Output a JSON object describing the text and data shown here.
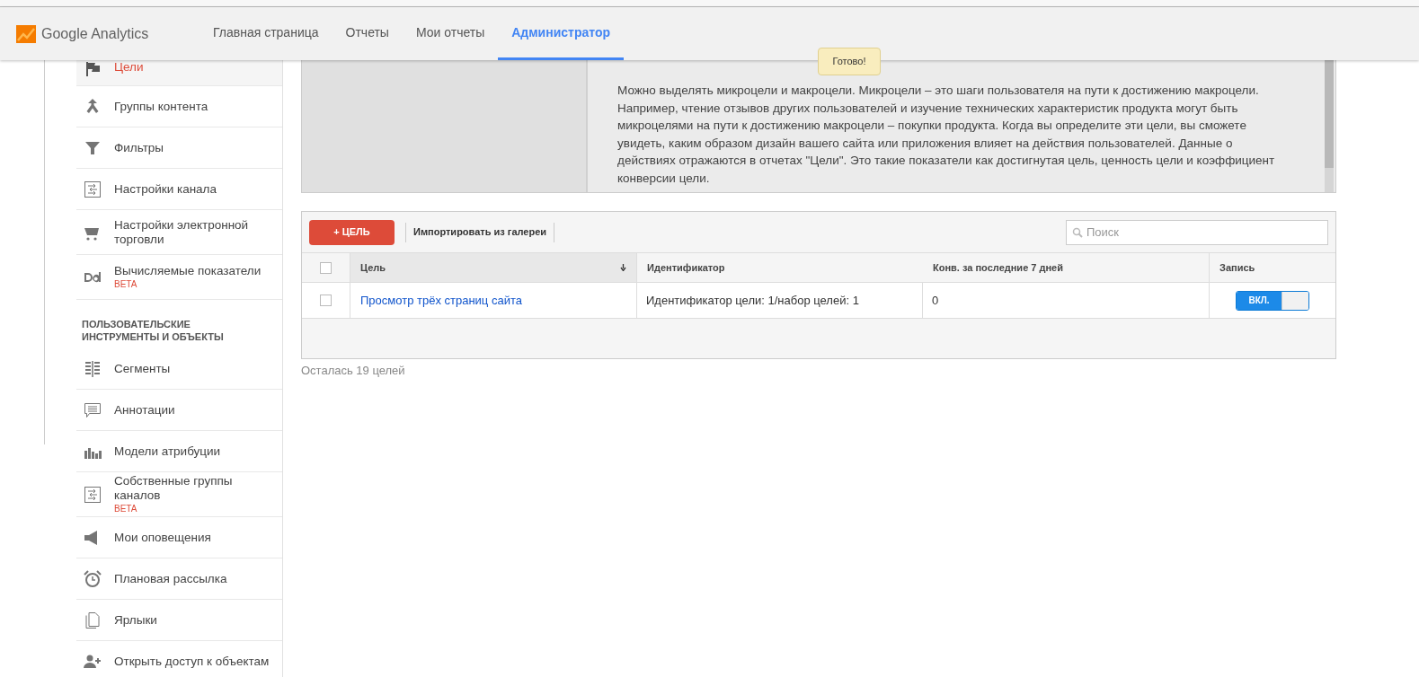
{
  "header": {
    "brand": "Google Analytics",
    "nav": [
      {
        "label": "Главная страница",
        "selected": false
      },
      {
        "label": "Отчеты",
        "selected": false
      },
      {
        "label": "Мои отчеты",
        "selected": false
      },
      {
        "label": "Администратор",
        "selected": true
      }
    ]
  },
  "tooltip": "Готово!",
  "sidebar": {
    "items": [
      {
        "label": "Цели",
        "selected": true
      },
      {
        "label": "Группы контента",
        "selected": false
      },
      {
        "label": "Фильтры",
        "selected": false
      },
      {
        "label": "Настройки канала",
        "selected": false
      },
      {
        "label": "Настройки электронной торговли",
        "selected": false
      },
      {
        "label": "Вычисляемые показатели",
        "beta": "BETA",
        "selected": false
      }
    ],
    "section": {
      "title": "ПОЛЬЗОВАТЕЛЬСКИЕ ИНСТРУМЕНТЫ И ОБЪЕКТЫ",
      "items": [
        {
          "label": "Сегменты",
          "selected": false
        },
        {
          "label": "Аннотации",
          "selected": false
        },
        {
          "label": "Модели атрибуции",
          "selected": false
        },
        {
          "label": "Собственные группы каналов",
          "beta": "BETA",
          "selected": false
        },
        {
          "label": "Мои оповещения",
          "selected": false
        },
        {
          "label": "Плановая рассылка",
          "selected": false
        },
        {
          "label": "Ярлыки",
          "selected": false
        },
        {
          "label": "Открыть доступ к объектам",
          "selected": false
        }
      ]
    }
  },
  "info": {
    "paragraphs": [
      "Можно выделять микроцели и макроцели. Микроцели – это шаги пользователя на пути к достижению макроцели. Например, чтение отзывов других пользователей и изучение технических характеристик продукта могут быть микроцелями на пути к достижению макроцели – покупки продукта. Когда вы определите эти цели, вы сможете увидеть, каким образом дизайн вашего сайта или приложения влияет на действия пользователей. Данные о действиях отражаются в отчетах \"Цели\". Это такие показатели как достигнутая цель, ценность цели и коэффициент конверсии цели."
    ]
  },
  "toolbar": {
    "new_button": "+ ЦЕЛЬ",
    "import_link": "Импортировать из галереи",
    "search": {
      "placeholder": "Поиск"
    }
  },
  "table": {
    "select_all": {
      "checked": false
    },
    "columns": [
      {
        "label": "Цель",
        "sorted": true
      },
      {
        "label": "Идентификатор",
        "sorted": false
      },
      {
        "label": "Конв. за последние 7 дней",
        "sorted": false
      },
      {
        "label": "Запись",
        "sorted": false
      }
    ],
    "rows": [
      {
        "checked": false,
        "name": "Просмотр трёх страниц сайта",
        "id": "Идентификатор цели: 1/набор целей: 1",
        "conversions": "0",
        "recording": {
          "on": true,
          "label": "ВКЛ."
        }
      }
    ]
  },
  "footer_note": "Осталась 19 целей"
}
